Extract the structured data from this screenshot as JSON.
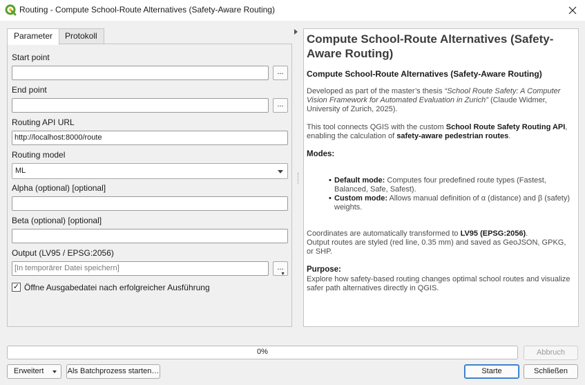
{
  "window": {
    "title": "Routing - Compute School-Route Alternatives (Safety-Aware Routing)",
    "app_icon": "qgis-logo-icon",
    "close_icon": "close-icon"
  },
  "tabs": [
    {
      "label": "Parameter",
      "active": true
    },
    {
      "label": "Protokoll",
      "active": false
    }
  ],
  "params": {
    "start_point": {
      "label": "Start point",
      "value": "",
      "button": "..."
    },
    "end_point": {
      "label": "End point",
      "value": "",
      "button": "..."
    },
    "api_url": {
      "label": "Routing API URL",
      "value": "http://localhost:8000/route"
    },
    "model": {
      "label": "Routing model",
      "value": "ML"
    },
    "alpha": {
      "label": "Alpha (optional) [optional]",
      "value": ""
    },
    "beta": {
      "label": "Beta (optional) [optional]",
      "value": ""
    },
    "output": {
      "label": "Output (LV95 / EPSG:2056)",
      "placeholder": "[In temporärer Datei speichern]",
      "button": "..."
    },
    "open_output": {
      "label": "Öffne Ausgabedatei nach erfolgreicher Ausführung",
      "checked": true,
      "mark": "✓"
    }
  },
  "help": {
    "title": "Compute School-Route Alternatives (Safety-Aware Routing)",
    "subtitle": "Compute School-Route Alternatives (Safety-Aware Routing)",
    "thesis_prefix": "Developed as part of the master’s thesis ",
    "thesis_title": "“School Route Safety: A Computer Vision Framework for Automated Evaluation in Zurich”",
    "thesis_suffix": " (Claude Widmer, University of Zurich, 2025).",
    "connects_prefix": "This tool connects QGIS with the custom ",
    "connects_bold": "School Route Safety Routing API",
    "connects_mid": ", enabling the calculation of ",
    "connects_bold2": "safety-aware pedestrian routes",
    "connects_end": ".",
    "modes_heading": "Modes:",
    "modes": [
      {
        "name": "Default mode:",
        "text": " Computes four predefined route types (Fastest, Balanced, Safe, Safest)."
      },
      {
        "name": "Custom mode:",
        "text": " Allows manual definition of α (distance) and β (safety) weights."
      }
    ],
    "coords_prefix": "Coordinates are automatically transformed to ",
    "coords_bold": "LV95 (EPSG:2056)",
    "coords_suffix": ".",
    "output_line": "Output routes are styled (red line, 0.35 mm) and saved as GeoJSON, GPKG, or SHP.",
    "purpose_heading": "Purpose:",
    "purpose_text": "Explore how safety-based routing changes optimal school routes and visualize safer path alternatives directly in QGIS."
  },
  "progress": {
    "value": 0,
    "label": "0%"
  },
  "buttons": {
    "cancel": "Abbruch",
    "advanced": "Erweitert",
    "batch": "Als Batchprozess starten…",
    "start": "Starte",
    "close": "Schließen"
  },
  "colors": {
    "accent": "#3a7bd5",
    "qgis_green": "#5aa02c",
    "qgis_yellow": "#f0b323"
  }
}
